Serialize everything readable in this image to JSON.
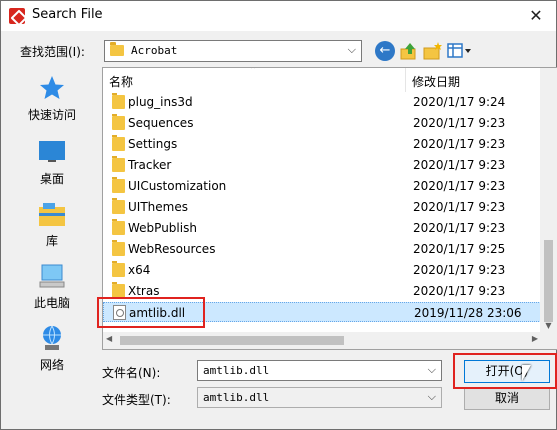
{
  "window": {
    "title": "Search File",
    "close_glyph": "✕"
  },
  "lookin": {
    "label": "查找范围(I):",
    "value": "Acrobat"
  },
  "toolbar": {
    "back_icon": "back-arrow-icon",
    "up_icon": "up-folder-icon",
    "new_folder_icon": "new-folder-icon",
    "views_icon": "view-menu-icon"
  },
  "places": [
    {
      "label": "快速访问",
      "icon": "star-icon"
    },
    {
      "label": "桌面",
      "icon": "desktop-icon"
    },
    {
      "label": "库",
      "icon": "library-icon"
    },
    {
      "label": "此电脑",
      "icon": "computer-icon"
    },
    {
      "label": "网络",
      "icon": "network-icon"
    }
  ],
  "filelist": {
    "columns": {
      "name": "名称",
      "date": "修改日期"
    },
    "rows": [
      {
        "name": "plug_ins3d",
        "date": "2020/1/17 9:24",
        "type": "folder"
      },
      {
        "name": "Sequences",
        "date": "2020/1/17 9:23",
        "type": "folder"
      },
      {
        "name": "Settings",
        "date": "2020/1/17 9:23",
        "type": "folder"
      },
      {
        "name": "Tracker",
        "date": "2020/1/17 9:23",
        "type": "folder"
      },
      {
        "name": "UICustomization",
        "date": "2020/1/17 9:23",
        "type": "folder"
      },
      {
        "name": "UIThemes",
        "date": "2020/1/17 9:23",
        "type": "folder"
      },
      {
        "name": "WebPublish",
        "date": "2020/1/17 9:23",
        "type": "folder"
      },
      {
        "name": "WebResources",
        "date": "2020/1/17 9:25",
        "type": "folder"
      },
      {
        "name": "x64",
        "date": "2020/1/17 9:23",
        "type": "folder"
      },
      {
        "name": "Xtras",
        "date": "2020/1/17 9:23",
        "type": "folder"
      },
      {
        "name": "amtlib.dll",
        "date": "2019/11/28 23:06",
        "type": "file",
        "selected": true
      }
    ]
  },
  "filename": {
    "label": "文件名(N):",
    "value": "amtlib.dll"
  },
  "filetype": {
    "label": "文件类型(T):",
    "value": "amtlib.dll"
  },
  "buttons": {
    "open": "打开(O)",
    "cancel": "取消"
  },
  "colors": {
    "selection": "#cce8ff",
    "highlight_box": "#e0231f",
    "accent": "#0078d7"
  }
}
